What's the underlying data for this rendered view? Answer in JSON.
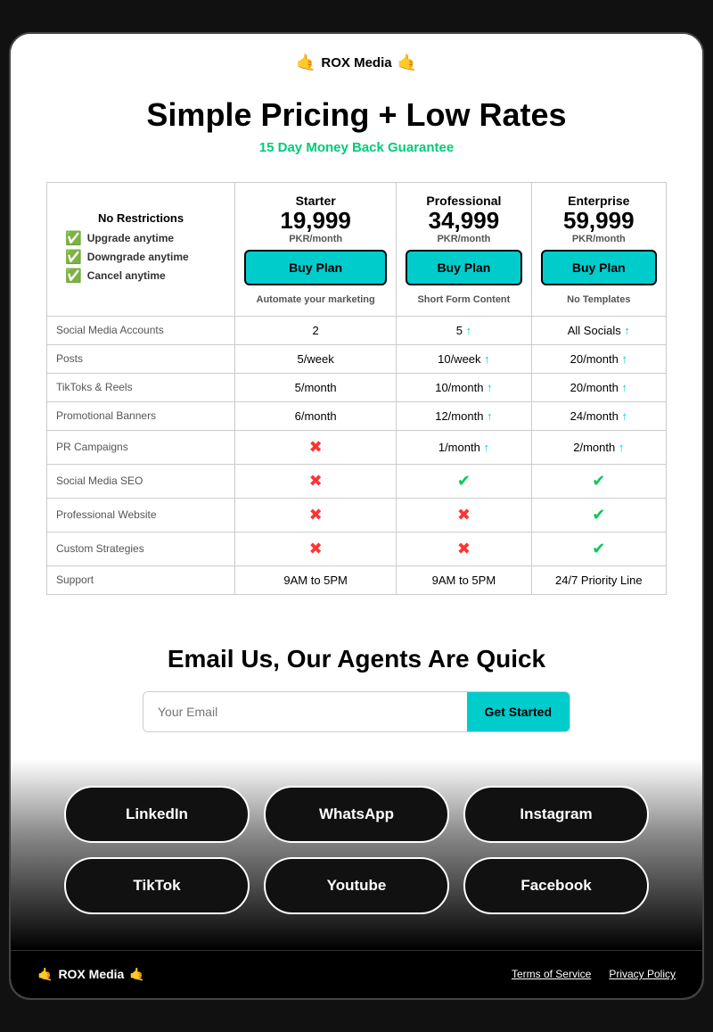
{
  "brand": {
    "name": "ROX Media",
    "hand_left": "🤙",
    "hand_right": "🤙"
  },
  "hero": {
    "title": "Simple Pricing + Low Rates",
    "guarantee": "15 Day Money Back Guarantee"
  },
  "no_restrictions": {
    "title": "No Restrictions",
    "items": [
      "Upgrade anytime",
      "Downgrade anytime",
      "Cancel anytime"
    ]
  },
  "plans": [
    {
      "name": "Starter",
      "price": "19,999",
      "currency": "PKR/month",
      "btn_label": "Buy Plan",
      "description": "Automate your marketing"
    },
    {
      "name": "Professional",
      "price": "34,999",
      "currency": "PKR/month",
      "btn_label": "Buy Plan",
      "description": "Short Form Content"
    },
    {
      "name": "Enterprise",
      "price": "59,999",
      "currency": "PKR/month",
      "btn_label": "Buy Plan",
      "description": "No Templates"
    }
  ],
  "table_rows": [
    {
      "label": "Social Media Accounts",
      "cols": [
        "2",
        "5 ↑",
        "All Socials ↑"
      ]
    },
    {
      "label": "Posts",
      "cols": [
        "5/week",
        "10/week ↑",
        "20/month ↑"
      ]
    },
    {
      "label": "TikToks & Reels",
      "cols": [
        "5/month",
        "10/month ↑",
        "20/month ↑"
      ]
    },
    {
      "label": "Promotional Banners",
      "cols": [
        "6/month",
        "12/month ↑",
        "24/month ↑"
      ]
    },
    {
      "label": "PR Campaigns",
      "cols": [
        "x",
        "1/month ↑",
        "2/month ↑"
      ]
    },
    {
      "label": "Social Media SEO",
      "cols": [
        "x",
        "check",
        "check"
      ]
    },
    {
      "label": "Professional Website",
      "cols": [
        "x",
        "x",
        "check"
      ]
    },
    {
      "label": "Custom Strategies",
      "cols": [
        "x",
        "x",
        "check"
      ]
    },
    {
      "label": "Support",
      "cols": [
        "9AM to 5PM",
        "9AM to 5PM",
        "24/7 Priority Line"
      ]
    }
  ],
  "email_section": {
    "heading": "Email Us, Our Agents Are Quick",
    "placeholder": "Your Email",
    "btn_label": "Get Started"
  },
  "social_buttons": [
    "LinkedIn",
    "WhatsApp",
    "Instagram",
    "TikTok",
    "Youtube",
    "Facebook"
  ],
  "footer": {
    "brand": "ROX Media",
    "links": [
      "Terms of Service",
      "Privacy Policy"
    ]
  }
}
